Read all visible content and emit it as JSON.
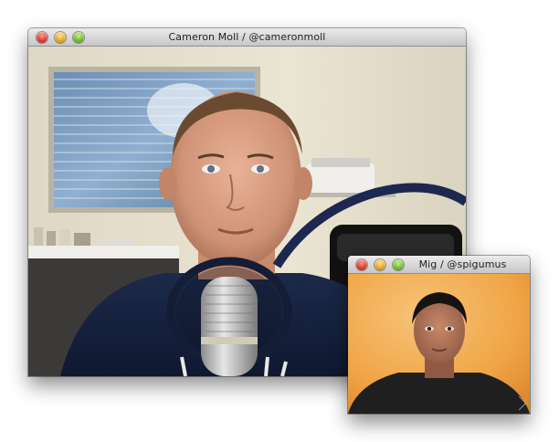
{
  "windows": {
    "main": {
      "title": "Cameron Moll / @cameronmoll",
      "controls": [
        "close",
        "minimize",
        "zoom"
      ]
    },
    "secondary": {
      "title": "Mig / @spigumus",
      "controls": [
        "close",
        "minimize",
        "zoom"
      ]
    }
  },
  "icons": {
    "close": "close-button-icon",
    "minimize": "minimize-button-icon",
    "zoom": "zoom-button-icon",
    "resize": "resize-grip-icon"
  },
  "colors": {
    "close": "#d8352a",
    "minimize": "#e3a21c",
    "zoom": "#6cb52a",
    "main_wall": "#e7e1cf",
    "secondary_wall": "#f0a545"
  }
}
